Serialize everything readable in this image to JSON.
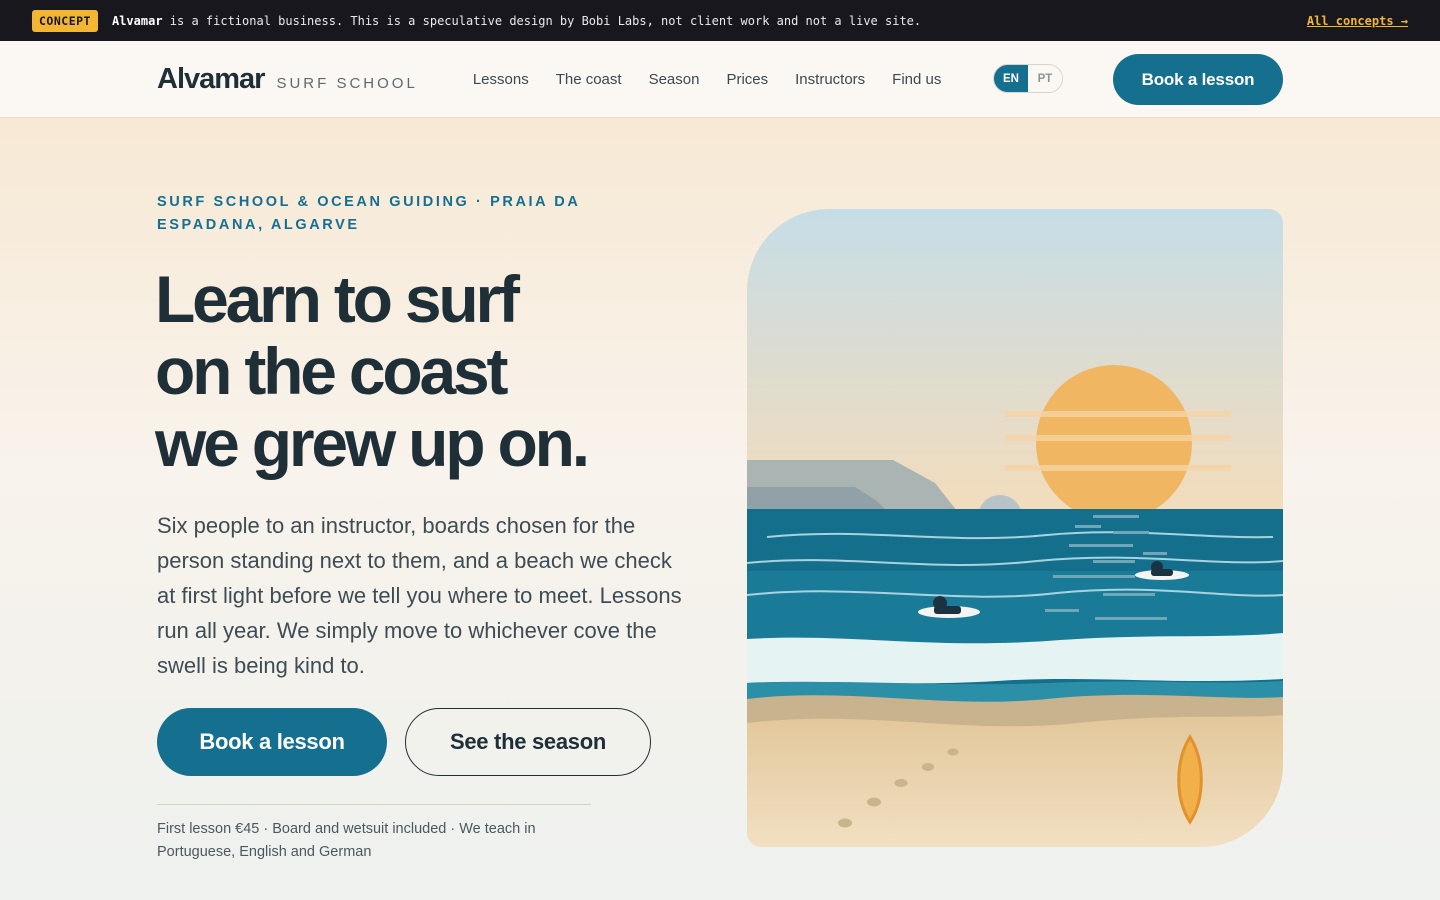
{
  "concept_bar": {
    "badge": "CONCEPT",
    "brand": "Alvamar",
    "text": " is a fictional business. This is a speculative design by Bobi Labs, not client work and not a live site.",
    "link": "All concepts →"
  },
  "nav": {
    "logo_name": "Alvamar",
    "logo_sub": "SURF SCHOOL",
    "links": [
      "Lessons",
      "The coast",
      "Season",
      "Prices",
      "Instructors",
      "Find us"
    ],
    "languages": [
      "EN",
      "PT"
    ],
    "active_language": "EN",
    "cta": "Book a lesson"
  },
  "hero": {
    "eyebrow": "SURF SCHOOL & OCEAN GUIDING · PRAIA DA ESPADANA, ALGARVE",
    "headline_lines": [
      "Learn to surf",
      "on the coast",
      "we grew up on."
    ],
    "lead": "Six people to an instructor, boards chosen for the person standing next to them, and a beach we check at first light before we tell you where to meet. Lessons run all year. We simply move to whichever cove the swell is being kind to.",
    "primary_button": "Book a lesson",
    "secondary_button": "See the season",
    "footnote": "First lesson €45 · Board and wetsuit included · We teach in Portuguese, English and German"
  },
  "colors": {
    "accent": "#156f8f",
    "badge": "#f2b632",
    "ink": "#1f2f38",
    "sun": "#f0b662",
    "sea": "#146f8c",
    "sand": "#e9d2a8"
  }
}
